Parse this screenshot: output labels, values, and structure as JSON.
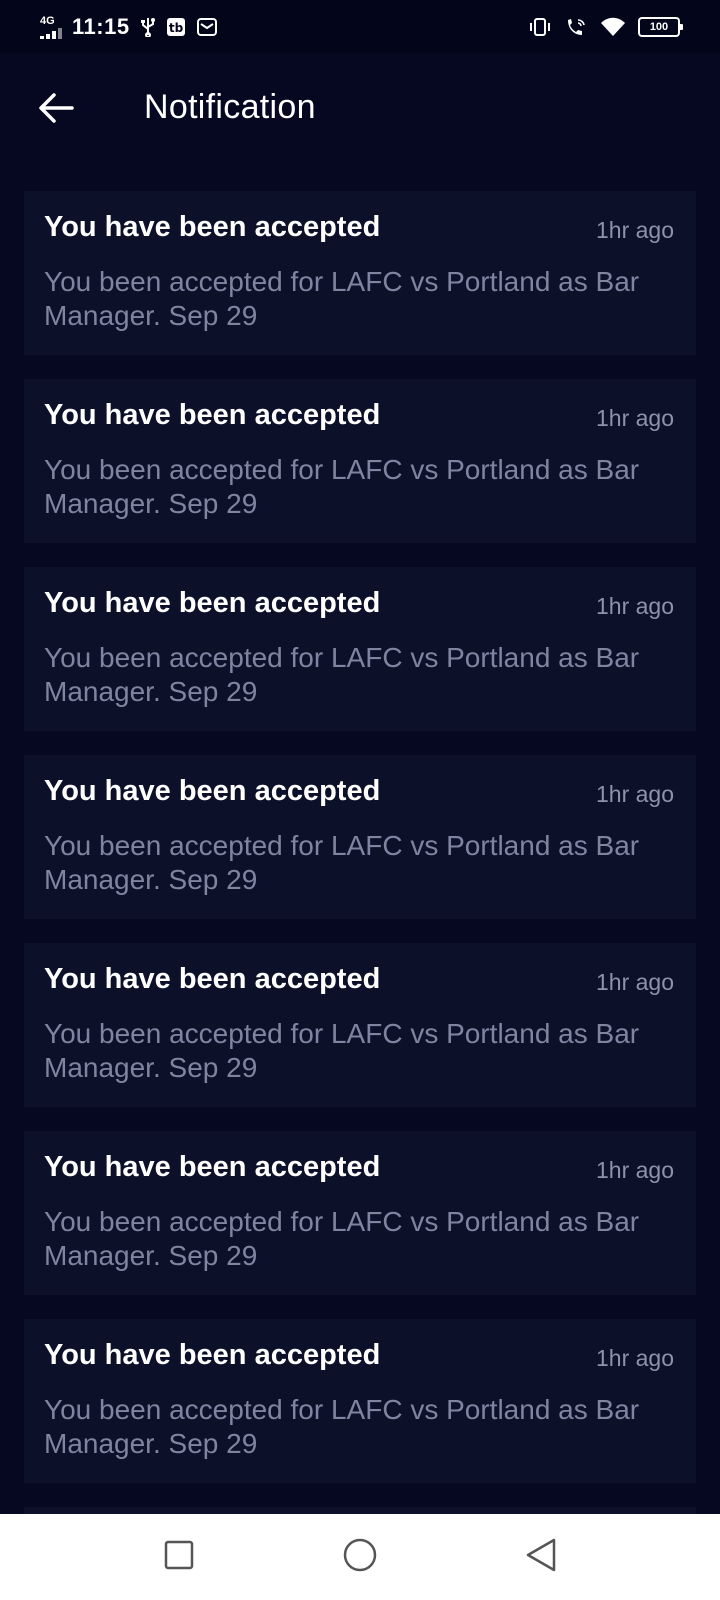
{
  "status_bar": {
    "network": "4G",
    "time": "11:15",
    "battery": "100"
  },
  "header": {
    "title": "Notification"
  },
  "notifications": [
    {
      "title": "You have been accepted",
      "time": "1hr ago",
      "body": "You been accepted for LAFC vs Portland as Bar Manager. Sep 29"
    },
    {
      "title": "You have been accepted",
      "time": "1hr ago",
      "body": "You been accepted for LAFC vs Portland as Bar Manager. Sep 29"
    },
    {
      "title": "You have been accepted",
      "time": "1hr ago",
      "body": "You been accepted for LAFC vs Portland as Bar Manager. Sep 29"
    },
    {
      "title": "You have been accepted",
      "time": "1hr ago",
      "body": "You been accepted for LAFC vs Portland as Bar Manager. Sep 29"
    },
    {
      "title": "You have been accepted",
      "time": "1hr ago",
      "body": "You been accepted for LAFC vs Portland as Bar Manager. Sep 29"
    },
    {
      "title": "You have been accepted",
      "time": "1hr ago",
      "body": "You been accepted for LAFC vs Portland as Bar Manager. Sep 29"
    },
    {
      "title": "You have been accepted",
      "time": "1hr ago",
      "body": "You been accepted for LAFC vs Portland as Bar Manager. Sep 29"
    }
  ],
  "icons": {
    "back": "arrow-left-icon",
    "usb": "usb-icon",
    "app": "app-notification-icon",
    "mail": "mail-icon",
    "vibrate": "vibrate-icon",
    "wifi_call": "wifi-calling-icon",
    "wifi": "wifi-icon",
    "recents": "square-icon",
    "home": "circle-icon",
    "back_nav": "triangle-back-icon"
  },
  "colors": {
    "background": "#050820",
    "card": "#0c1029",
    "title": "#ffffff",
    "body_text": "#7f84a0",
    "time_text": "#8d93ad"
  }
}
